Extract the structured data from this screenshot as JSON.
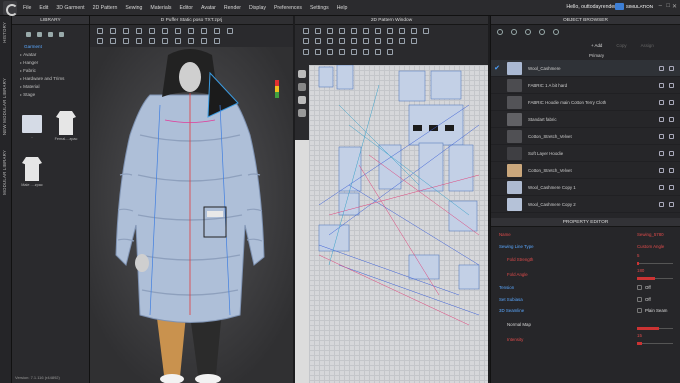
{
  "menubar": {
    "items": [
      "File",
      "Edit",
      "3D Garment",
      "2D Pattern",
      "Sewing",
      "Materials",
      "Editor",
      "Avatar",
      "Render",
      "Display",
      "Preferences",
      "Settings",
      "Help"
    ],
    "user": "Hello, outtodayrender",
    "mode": "SIMULATION"
  },
  "vtabs": [
    "HISTORY",
    "NEW MODULAR LIBRARY",
    "MODULAR LIBRARY"
  ],
  "library": {
    "title": "LIBRARY",
    "tree": [
      {
        "label": "Garment",
        "selected": true
      },
      {
        "label": "Avatar"
      },
      {
        "label": "Hanger"
      },
      {
        "label": "Fabric"
      },
      {
        "label": "Hardware and Trims"
      },
      {
        "label": "Material"
      },
      {
        "label": "Stage"
      }
    ],
    "files": [
      {
        "name": "..",
        "color": "#d5dbe6"
      },
      {
        "name": "Femal....zpac",
        "color": "#e6e6e6"
      },
      {
        "name": "Male ....zpac",
        "color": "#e6e6e6"
      }
    ],
    "version": "Version: 7.1.116 (r44892)"
  },
  "window3d": {
    "title": "D Puffer Static poso TXT.zprj",
    "coat_color": "#aebfd8"
  },
  "window2d": {
    "title": "2D Pattern Window"
  },
  "object_browser": {
    "title": "OBJECT BROWSER",
    "actions": {
      "add": "+ Add",
      "copy": "Copy",
      "assign": "Assign"
    },
    "group": "Primary",
    "fabrics": [
      {
        "name": "Wool_Cashmere",
        "color": "#aab9d3",
        "checked": true
      },
      {
        "name": "FABRIC 1 A bit hard",
        "color": "#4c4c50",
        "checked": false
      },
      {
        "name": "FABRIC Hoodie main Cotton Terry Cloth",
        "color": "#535357",
        "checked": false
      },
      {
        "name": "Standart fabric",
        "color": "#616165",
        "checked": false
      },
      {
        "name": "Cotton_Stretch_Velvet",
        "color": "#505054",
        "checked": false
      },
      {
        "name": "Soft Layer Hoodie",
        "color": "#3f3f43",
        "checked": false
      },
      {
        "name": "Cotton_Stretch_Velvet",
        "color": "#caa77c",
        "checked": false
      },
      {
        "name": "Wool_Cashmere Copy 1",
        "color": "#aebad0",
        "checked": false
      },
      {
        "name": "Wool_Cashmere Copy 2",
        "color": "#b5c2d8",
        "checked": false
      }
    ]
  },
  "property_editor": {
    "title": "PROPERTY EDITOR",
    "rows": [
      {
        "key": "Name",
        "value": "Sewing_5780",
        "kstyle": "red",
        "vstyle": "red"
      },
      {
        "key": "Sewing Line Type",
        "value": "Custom Angle",
        "kstyle": "blue",
        "vstyle": "red"
      },
      {
        "key": "Fold Strength",
        "value": "5",
        "kstyle": "red",
        "vstyle": "red",
        "slider": 0.05
      },
      {
        "key": "Fold Angle",
        "value": "180",
        "kstyle": "red",
        "vstyle": "red",
        "slider": 0.5
      },
      {
        "key": "Tension",
        "value": "Off",
        "kstyle": "blue",
        "vstyle": "w",
        "toggle": true
      },
      {
        "key": "Set Subiasa",
        "value": "Off",
        "kstyle": "blue",
        "vstyle": "w",
        "toggle": true
      },
      {
        "key": "3D Seamline",
        "value": "Plain Seam",
        "kstyle": "blue",
        "vstyle": "w",
        "toggle": true
      },
      {
        "key": "Normal Map",
        "value": "",
        "kstyle": "w",
        "vstyle": "w",
        "slider": 0.6
      },
      {
        "key": "Intensity",
        "value": "15",
        "kstyle": "red",
        "vstyle": "red",
        "slider": 0.15
      }
    ]
  }
}
